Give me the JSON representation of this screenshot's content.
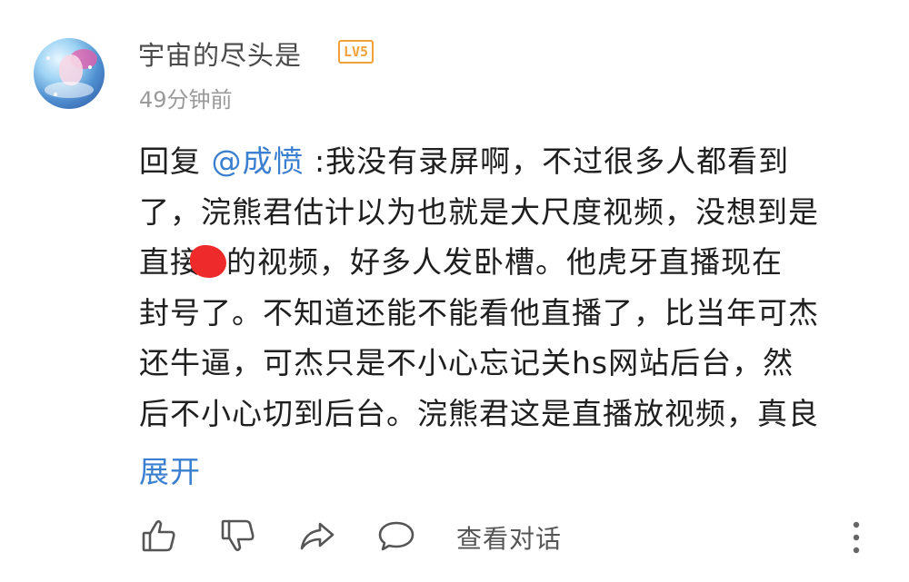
{
  "user": {
    "name": "宇宙的尽头是",
    "level_badge": "LV5",
    "timestamp": "49分钟前"
  },
  "comment": {
    "reply_prefix": "回复 ",
    "mention": "@成愤",
    "lines": [
      " :我没有录屏啊，不过很多人都看到",
      "了，浣熊君估计以为也就是大尺度视频，没想到是",
      "直接",
      "的视频，好多人发卧槽。他虎牙直播现在",
      "封号了。不知道还能不能看他直播了，比当年可杰",
      "还牛逼，可杰只是不小心忘记关hs网站后台，然",
      "后不小心切到后台。浣熊君这是直播放视频，真良"
    ],
    "expand_label": "展开"
  },
  "actions": {
    "like_icon": "thumbs-up-icon",
    "dislike_icon": "thumbs-down-icon",
    "share_icon": "share-icon",
    "reply_icon": "comment-bubble-icon",
    "view_dialog_label": "查看对话",
    "more_icon": "more-vertical-icon"
  },
  "colors": {
    "mention": "#3a7fd0",
    "level_badge": "#f2a13a",
    "redaction": "#ee2a2a"
  }
}
